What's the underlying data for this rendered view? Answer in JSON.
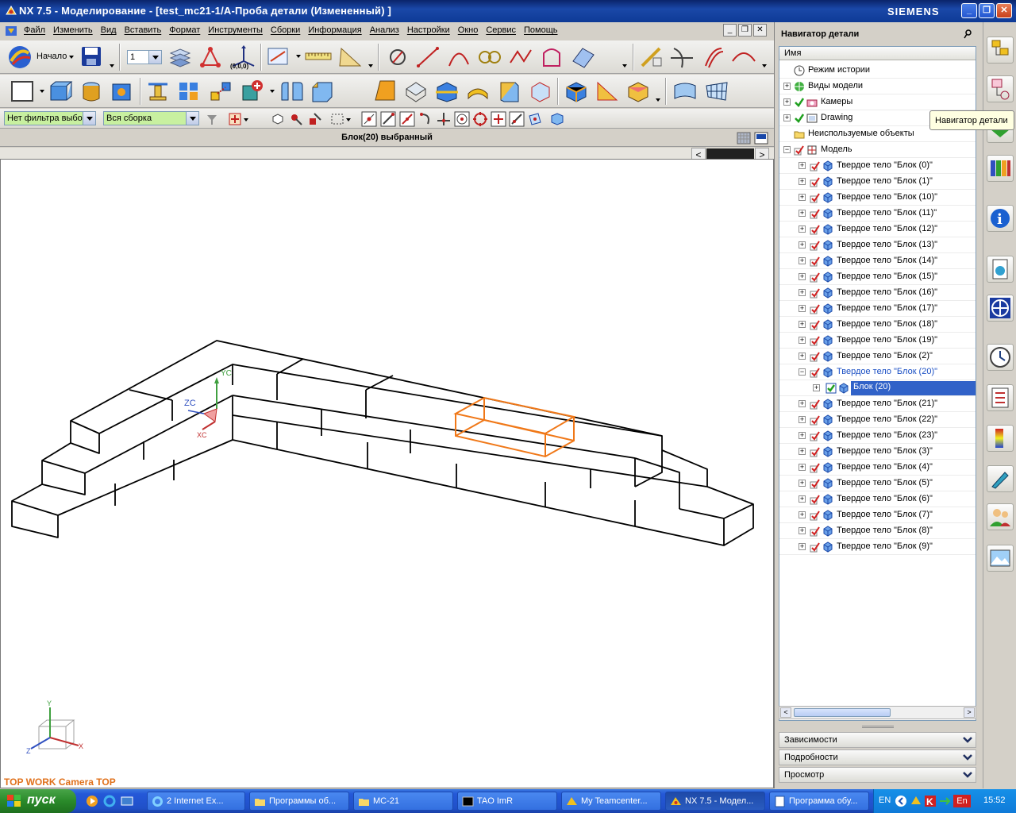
{
  "window": {
    "title": "NX 7.5 - Моделирование - [test_mc21-1/A-Проба детали (Измененный) ]",
    "brand": "SIEMENS",
    "min": "_",
    "max": "❐",
    "close": "✕"
  },
  "menu": {
    "items": [
      "Файл",
      "Изменить",
      "Вид",
      "Вставить",
      "Формат",
      "Инструменты",
      "Сборки",
      "Информация",
      "Анализ",
      "Настройки",
      "Окно",
      "Сервис",
      "Помощь"
    ]
  },
  "toolbar": {
    "start_label": "Начало",
    "layer_value": "1",
    "coord_label": "(0,0,0)",
    "filter_value": "Нет фильтра выбо",
    "assembly_value": "Вся сборка"
  },
  "status": {
    "message": "Блок(20) выбранный"
  },
  "viewport": {
    "view_label": "TOP WORK Camera TOP",
    "wcs_labels": {
      "y": "YC",
      "z": "ZC",
      "x": "XC"
    },
    "triad_labels": {
      "y": "Y",
      "z": "Z",
      "x": "X"
    },
    "highlight_color": "#f07818"
  },
  "navigator": {
    "title": "Навигатор детали",
    "column_name": "Имя",
    "top_items": [
      "Режим истории",
      "Виды модели",
      "Камеры",
      "Drawing",
      "Неиспользуемые объекты",
      "Модель"
    ],
    "bodies": [
      "Твердое тело \"Блок (0)\"",
      "Твердое тело \"Блок (1)\"",
      "Твердое тело \"Блок (10)\"",
      "Твердое тело \"Блок (11)\"",
      "Твердое тело \"Блок (12)\"",
      "Твердое тело \"Блок (13)\"",
      "Твердое тело \"Блок (14)\"",
      "Твердое тело \"Блок (15)\"",
      "Твердое тело \"Блок (16)\"",
      "Твердое тело \"Блок (17)\"",
      "Твердое тело \"Блок (18)\"",
      "Твердое тело \"Блок (19)\"",
      "Твердое тело \"Блок (2)\"",
      "Твердое тело \"Блок (20)\"",
      "Твердое тело \"Блок (21)\"",
      "Твердое тело \"Блок (22)\"",
      "Твердое тело \"Блок (23)\"",
      "Твердое тело \"Блок (3)\"",
      "Твердое тело \"Блок (4)\"",
      "Твердое тело \"Блок (5)\"",
      "Твердое тело \"Блок (6)\"",
      "Твердое тело \"Блок (7)\"",
      "Твердое тело \"Блок (8)\"",
      "Твердое тело \"Блок (9)\""
    ],
    "selected_body_index": 13,
    "selected_child": "Блок (20)",
    "panels": [
      "Зависимости",
      "Подробности",
      "Просмотр"
    ],
    "tooltip": "Навигатор детали"
  },
  "taskbar": {
    "start": "пуск",
    "tasks": [
      "2 Internet Ex...",
      "Программы об...",
      "МС-21",
      "TAO ImR",
      "My Teamcenter...",
      "NX 7.5 - Модел...",
      "Программа обу..."
    ],
    "lang": "EN",
    "lang2": "En",
    "clock": "15:52"
  }
}
